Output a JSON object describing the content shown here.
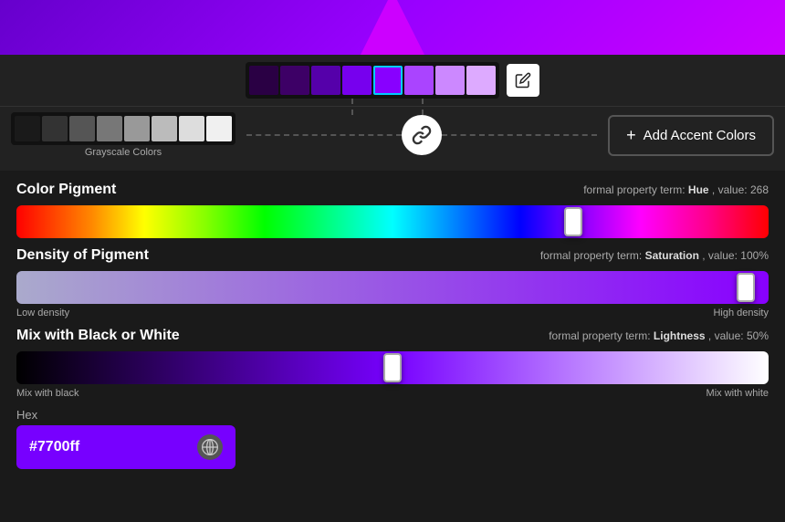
{
  "top": {
    "swatches": [
      {
        "color": "#2a0044",
        "selected": false
      },
      {
        "color": "#3d0066",
        "selected": false
      },
      {
        "color": "#5500aa",
        "selected": false
      },
      {
        "color": "#7700ee",
        "selected": false
      },
      {
        "color": "#8800ff",
        "selected": true
      },
      {
        "color": "#aa44ff",
        "selected": false
      },
      {
        "color": "#cc88ff",
        "selected": false
      },
      {
        "color": "#ddaaff",
        "selected": false
      }
    ],
    "edit_button_label": "Edit"
  },
  "grayscale": {
    "label": "Grayscale Colors",
    "swatches": [
      "#1a1a1a",
      "#333333",
      "#555555",
      "#777777",
      "#999999",
      "#bbbbbb",
      "#dddddd",
      "#f0f0f0"
    ]
  },
  "connector": {
    "link_aria": "Link colors"
  },
  "add_accent": {
    "label": "Add Accent Colors",
    "plus": "+"
  },
  "color_pigment": {
    "title": "Color Pigment",
    "formal_label": "formal property term:",
    "formal_property": "Hue",
    "formal_separator": ", value:",
    "formal_value": "268",
    "thumb_position_pct": 74
  },
  "density": {
    "title": "Density of Pigment",
    "formal_label": "formal property term:",
    "formal_property": "Saturation",
    "formal_separator": ", value:",
    "formal_value": "100%",
    "thumb_position_pct": 97,
    "low_label": "Low density",
    "high_label": "High density"
  },
  "lightness": {
    "title": "Mix with Black or White",
    "formal_label": "formal property term:",
    "formal_property": "Lightness",
    "formal_separator": ", value:",
    "formal_value": "50%",
    "thumb_position_pct": 50,
    "low_label": "Mix with black",
    "high_label": "Mix with white"
  },
  "hex": {
    "label": "Hex",
    "value": "#7700ff"
  }
}
